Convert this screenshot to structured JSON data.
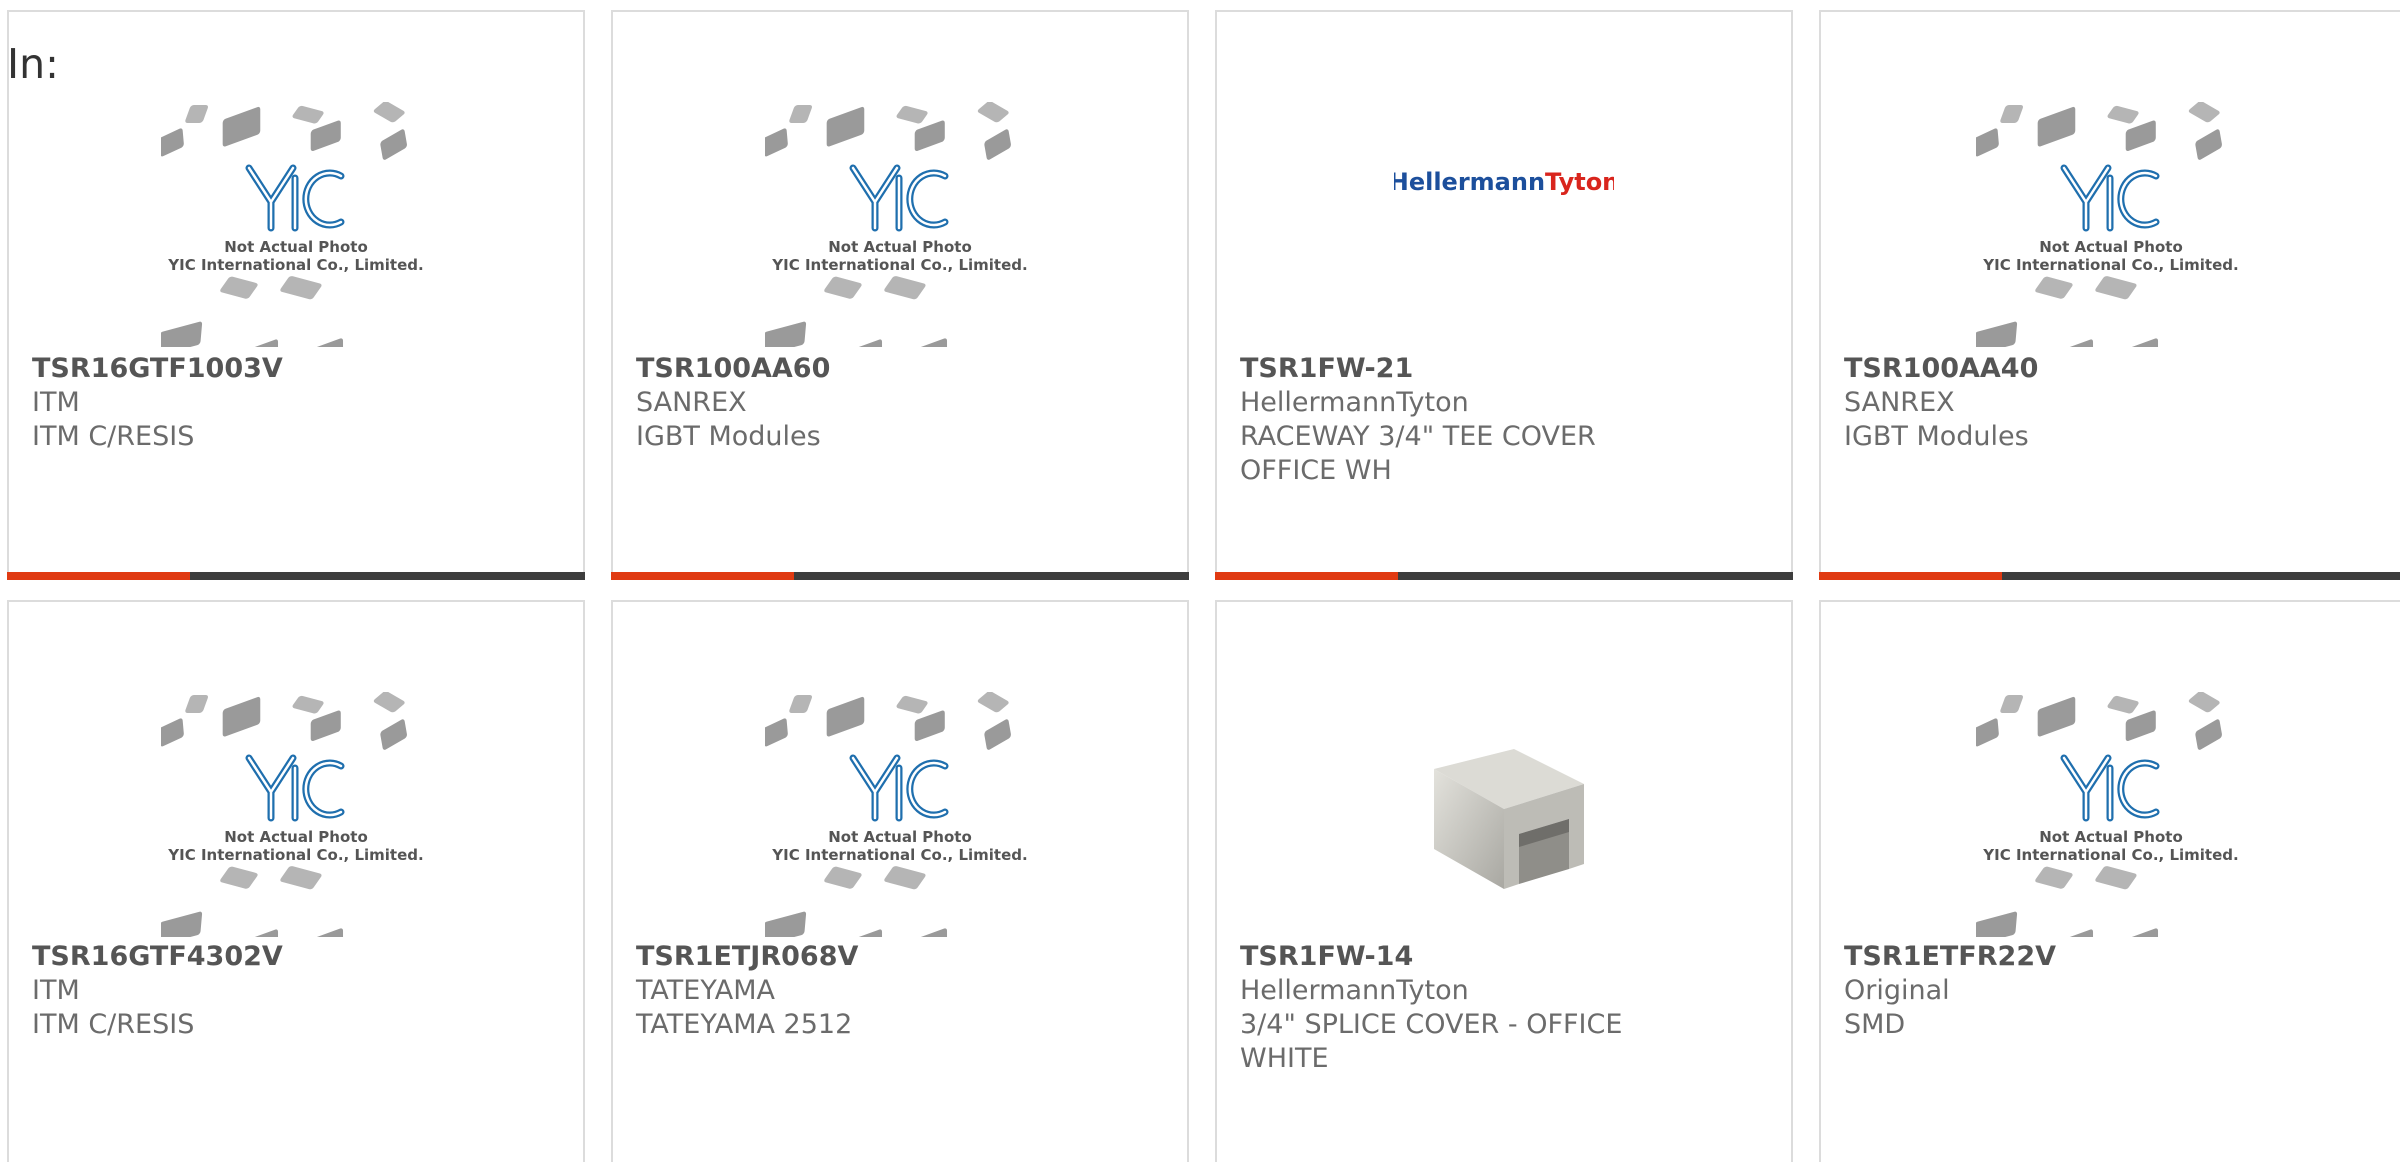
{
  "filter_label": "In:",
  "placeholder": {
    "title": "YIC",
    "line1": "Not Actual Photo",
    "line2": "YIC International Co., Limited."
  },
  "brand_logo_text": {
    "part1": "Hellermann",
    "part2": "Tyton"
  },
  "colors": {
    "accent": "#e03a12",
    "bar": "#3d3d3d",
    "yic_blue": "#1f6fae",
    "hellermann_blue": "#1c4f9c",
    "tyton_red": "#d9251d"
  },
  "products": [
    {
      "part": "TSR16GTF1003V",
      "manufacturer": "ITM",
      "description": "ITM C/RESIS",
      "image": "placeholder"
    },
    {
      "part": "TSR100AA60",
      "manufacturer": "SANREX",
      "description": "IGBT Modules",
      "image": "placeholder"
    },
    {
      "part": "TSR1FW-21",
      "manufacturer": "HellermannTyton",
      "description": "RACEWAY 3/4\" TEE COVER OFFICE WH",
      "image": "hellermann-logo"
    },
    {
      "part": "TSR100AA40",
      "manufacturer": "SANREX",
      "description": "IGBT Modules",
      "image": "placeholder"
    },
    {
      "part": "TSR16GTF4302V",
      "manufacturer": "ITM",
      "description": "ITM C/RESIS",
      "image": "placeholder"
    },
    {
      "part": "TSR1ETJR068V",
      "manufacturer": "TATEYAMA",
      "description": "TATEYAMA 2512",
      "image": "placeholder"
    },
    {
      "part": "TSR1FW-14",
      "manufacturer": "HellermannTyton",
      "description": "3/4\" SPLICE COVER - OFFICE WHITE",
      "image": "splice-cover-photo"
    },
    {
      "part": "TSR1ETFR22V",
      "manufacturer": "Original",
      "description": "SMD",
      "image": "placeholder"
    }
  ]
}
